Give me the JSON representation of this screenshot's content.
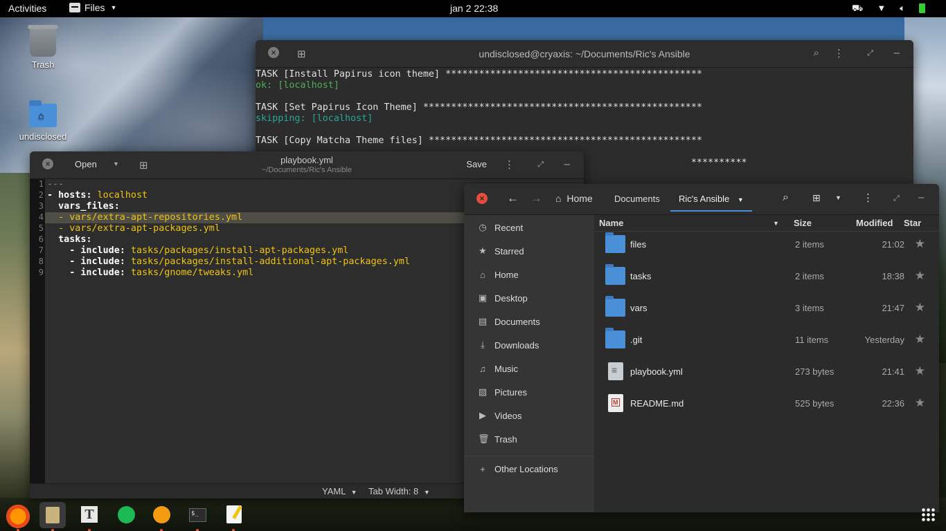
{
  "topbar": {
    "activities": "Activities",
    "app_menu": "Files",
    "clock": "jan 2  22:38"
  },
  "desktop": {
    "trash_label": "Trash",
    "home_label": "undisclosed"
  },
  "terminal": {
    "title": "undisclosed@cryaxis: ~/Documents/Ric's Ansible",
    "lines": [
      "TASK [Install Papirus icon theme] **********************************************",
      "ok: [localhost]",
      "",
      "TASK [Set Papirus Icon Theme] **************************************************",
      "skipping: [localhost]",
      "",
      "TASK [Copy Matcha Theme files] *************************************************",
      "",
      "                                                                              **********"
    ]
  },
  "gedit": {
    "open_label": "Open",
    "title": "playbook.yml",
    "subtitle": "~/Documents/Ric's Ansible",
    "save_label": "Save",
    "line_numbers": [
      "1",
      "2",
      "3",
      "4",
      "5",
      "6",
      "7",
      "8",
      "9"
    ],
    "code": {
      "l1": "---",
      "l2_dash": "- ",
      "l2_key": "hosts",
      "l2_val": "localhost",
      "l3_key": "vars_files",
      "l4_val": "vars/extra-apt-repositories.yml",
      "l5_val": "vars/extra-apt-packages.yml",
      "l6_key": "tasks",
      "l7_key": "include",
      "l7_val": "tasks/packages/install-apt-packages.yml",
      "l8_key": "include",
      "l8_val": "tasks/packages/install-additional-apt-packages.yml",
      "l9_key": "include",
      "l9_val": "tasks/gnome/tweaks.yml"
    },
    "status": {
      "language": "YAML",
      "tab_width": "Tab Width: 8"
    }
  },
  "files": {
    "breadcrumb": {
      "home": "Home",
      "documents": "Documents",
      "current": "Ric's Ansible"
    },
    "sidebar": {
      "items": [
        {
          "label": "Recent",
          "icon": "clock-icon"
        },
        {
          "label": "Starred",
          "icon": "star-icon"
        },
        {
          "label": "Home",
          "icon": "home-icon"
        },
        {
          "label": "Desktop",
          "icon": "desktop-icon"
        },
        {
          "label": "Documents",
          "icon": "document-icon"
        },
        {
          "label": "Downloads",
          "icon": "download-icon"
        },
        {
          "label": "Music",
          "icon": "music-icon"
        },
        {
          "label": "Pictures",
          "icon": "picture-icon"
        },
        {
          "label": "Videos",
          "icon": "video-icon"
        },
        {
          "label": "Trash",
          "icon": "trash-icon"
        }
      ],
      "other_locations": "Other Locations"
    },
    "columns": {
      "name": "Name",
      "size": "Size",
      "modified": "Modified",
      "star": "Star"
    },
    "rows": [
      {
        "name": "files",
        "size": "2 items",
        "modified": "21:02",
        "type": "folder"
      },
      {
        "name": "tasks",
        "size": "2 items",
        "modified": "18:38",
        "type": "folder"
      },
      {
        "name": "vars",
        "size": "3 items",
        "modified": "21:47",
        "type": "folder"
      },
      {
        "name": ".git",
        "size": "11 items",
        "modified": "Yesterday",
        "type": "folder"
      },
      {
        "name": "playbook.yml",
        "size": "273 bytes",
        "modified": "21:41",
        "type": "text"
      },
      {
        "name": "README.md",
        "size": "525 bytes",
        "modified": "22:36",
        "type": "markdown"
      }
    ]
  },
  "dock": {
    "apps": [
      "firefox-icon",
      "files-icon",
      "typora-icon",
      "spotify-icon",
      "hotspot-icon",
      "terminal-icon",
      "text-editor-icon",
      "show-apps-icon"
    ]
  },
  "colors": {
    "accent": "#4a90d9",
    "yaml_value": "#f1c40f",
    "term_ok": "#4caf50",
    "term_skip": "#26a69a",
    "close_red": "#e74c3c"
  }
}
